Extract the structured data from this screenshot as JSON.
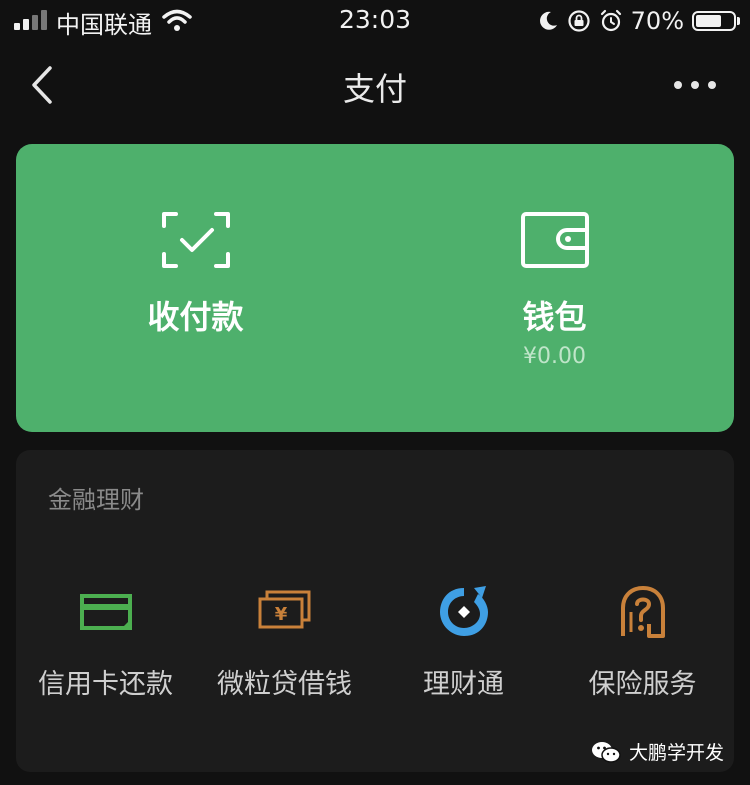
{
  "status_bar": {
    "carrier": "中国联通",
    "time": "23:03",
    "battery_percent": "70%",
    "battery_level": 0.7,
    "icons": [
      "signal-icon",
      "wifi-icon",
      "moon-icon",
      "rotation-lock-icon",
      "alarm-icon",
      "battery-icon"
    ]
  },
  "nav": {
    "title": "支付",
    "back_icon": "chevron-left-icon",
    "more_icon": "more-dots-icon"
  },
  "green_card": {
    "items": [
      {
        "label": "收付款",
        "icon": "scan-check-icon"
      },
      {
        "label": "钱包",
        "amount": "¥0.00",
        "icon": "wallet-icon"
      }
    ]
  },
  "finance": {
    "title": "金融理财",
    "items": [
      {
        "label": "信用卡还款",
        "icon": "credit-card-icon",
        "color": "#4caf50"
      },
      {
        "label": "微粒贷借钱",
        "icon": "cash-bill-icon",
        "color": "#c9813a"
      },
      {
        "label": "理财通",
        "icon": "licaitong-icon",
        "color": "#3f9fe4"
      },
      {
        "label": "保险服务",
        "icon": "insurance-icon",
        "color": "#c9813a"
      }
    ]
  },
  "watermark": {
    "text": "大鹏学开发",
    "icon": "wechat-icon"
  },
  "colors": {
    "background": "#111111",
    "card_green": "#4eb06c",
    "panel": "#1c1c1c"
  }
}
